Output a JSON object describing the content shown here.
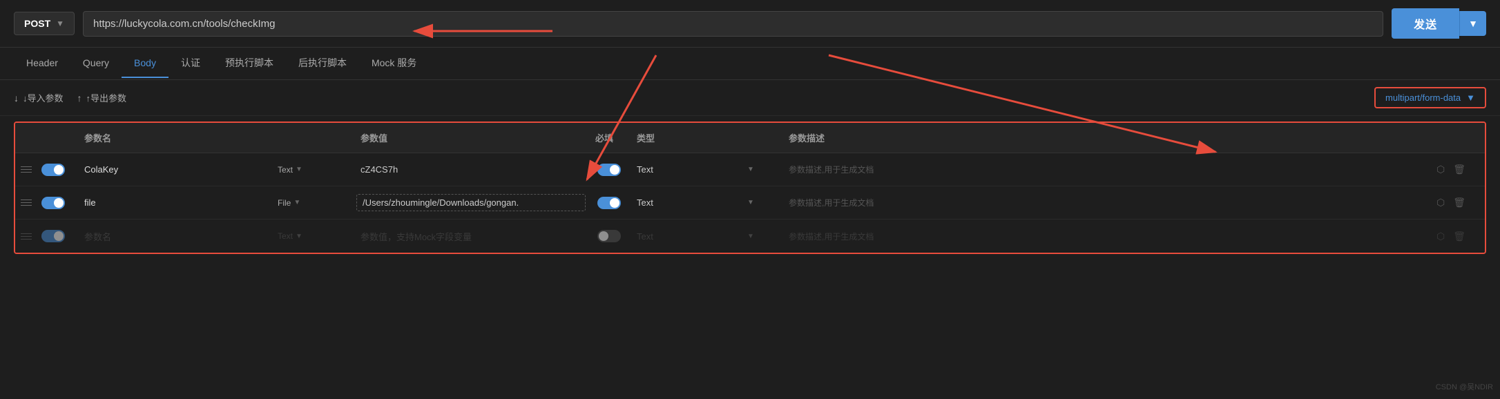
{
  "url_bar": {
    "method": "POST",
    "url": "https://luckycola.com.cn/tools/checkImg",
    "send_label": "发送"
  },
  "nav": {
    "tabs": [
      {
        "label": "Header",
        "active": false
      },
      {
        "label": "Query",
        "active": false
      },
      {
        "label": "Body",
        "active": true
      },
      {
        "label": "认证",
        "active": false
      },
      {
        "label": "预执行脚本",
        "active": false
      },
      {
        "label": "后执行脚本",
        "active": false
      },
      {
        "label": "Mock 服务",
        "active": false
      }
    ]
  },
  "body_toolbar": {
    "import_label": "↓导入参数",
    "export_label": "↑导出参数",
    "content_type": "multipart/form-data"
  },
  "table": {
    "headers": [
      "",
      "",
      "参数名",
      "",
      "参数值",
      "必填",
      "类型",
      "",
      "参数描述",
      ""
    ],
    "rows": [
      {
        "enabled": true,
        "name": "ColaKey",
        "type": "Text",
        "value": "cZ4CS7h",
        "required": true,
        "value_type": "Text",
        "desc": "参数描述,用于生成文档",
        "dashed": false
      },
      {
        "enabled": true,
        "name": "file",
        "type": "File",
        "value": "/Users/zhoumingle/Downloads/gongan.",
        "required": true,
        "value_type": "Text",
        "desc": "参数描述,用于生成文档",
        "dashed": true
      },
      {
        "enabled": true,
        "name": "参数名",
        "type": "Text",
        "value": "参数值，支持Mock字段变量",
        "required": false,
        "value_type": "Text",
        "desc": "参数描述,用于生成文档",
        "dashed": false,
        "placeholder": true
      }
    ]
  },
  "watermark": "CSDN @吴NDIR"
}
